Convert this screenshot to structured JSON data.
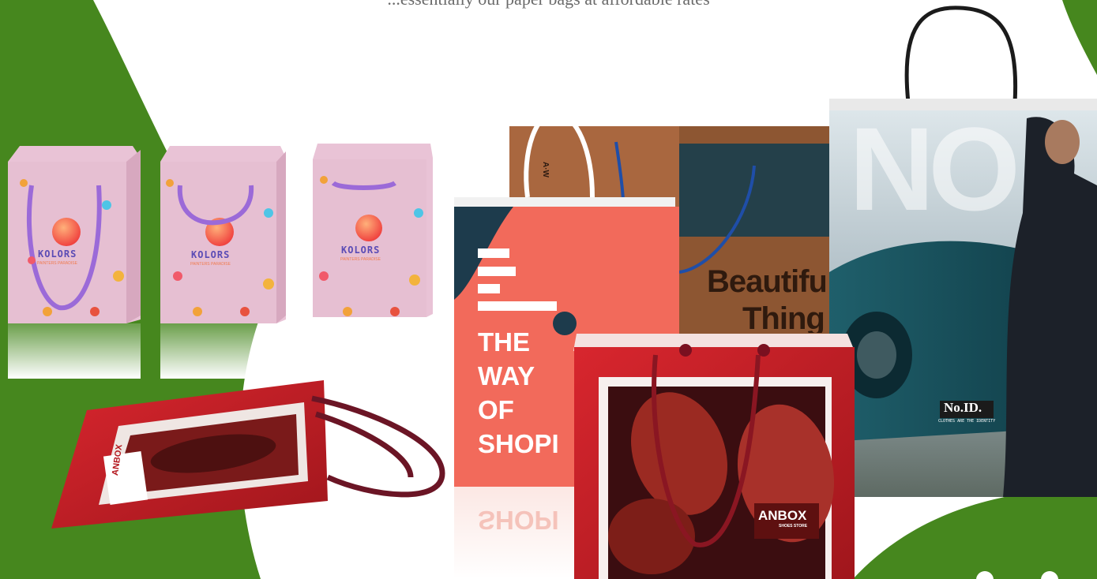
{
  "hero": {
    "caption": "...essentially our paper bags at affordable rates",
    "brand_green": "#46871e",
    "bags": {
      "kolors_1": {
        "brand": "KOLORS",
        "tagline": "PAINTERS PARADISE"
      },
      "kolors_2": {
        "brand": "KOLORS",
        "tagline": "PAINTERS PARADISE"
      },
      "kolors_3": {
        "brand": "KOLORS",
        "tagline": "PAINTERS PARADISE"
      },
      "anbox_flat": {
        "brand": "ANBOX"
      },
      "way_of_shop": {
        "line1": "THE",
        "line2": "WAY",
        "line3": "OF",
        "line4": "SHOPI",
        "reflection": "SHOPI"
      },
      "aw_brown": {
        "logo": "A·W",
        "line1": "Beautifu",
        "line2": "Thing"
      },
      "anbox_red": {
        "brand": "ANBOX",
        "tagline": "SHOES STORE"
      },
      "noid": {
        "headline": "NO",
        "brand": "No.ID.",
        "tagline": "CLOTHES ARE THE IDENTITY"
      }
    }
  },
  "carousel": {
    "active_index": 0,
    "count": 2
  }
}
